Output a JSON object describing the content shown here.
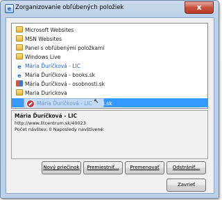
{
  "window": {
    "title": "Zorganizovanie obľúbených položiek",
    "close_glyph": "x"
  },
  "tree": {
    "items": [
      {
        "label": "Microsoft Websites",
        "icon": "folder-icon",
        "color": "#1a1a1a"
      },
      {
        "label": "MSN Websites",
        "icon": "folder-icon",
        "color": "#1a1a1a"
      },
      {
        "label": "Panel s obľúbenými položkami",
        "icon": "folder-icon",
        "color": "#1a1a1a"
      },
      {
        "label": "Windows Live",
        "icon": "folder-icon",
        "color": "#1a1a1a"
      },
      {
        "label": "Mária Ďuríčková - LIC",
        "icon": "ie-icon",
        "color": "#2462c9"
      },
      {
        "label": "Mária Ďuríčková - books.sk",
        "icon": "ie-icon",
        "color": "#1a1a1a"
      },
      {
        "label": "Mária Ďuríčková - osobnosti.sk",
        "icon": "flag-icon",
        "color": "#1a1a1a"
      },
      {
        "label": "Maria Durickova",
        "icon": "folder-icon",
        "color": "#1a1a1a"
      }
    ],
    "dragged_item": {
      "label_start": "Mária Ďuríčková - LIC",
      "label_end": "s.sk"
    }
  },
  "details": {
    "name": "Mária Ďuríčková - LIC",
    "url": "http://www.litcentrum.sk/40023",
    "stats": "Počet návštev: 0    Naposledy navštívené:"
  },
  "buttons": {
    "new_folder": "Nový priečinok",
    "move": "Premiestniť...",
    "rename": "Premenovať",
    "delete": "Odstrániť...",
    "close": "Zavrieť"
  }
}
